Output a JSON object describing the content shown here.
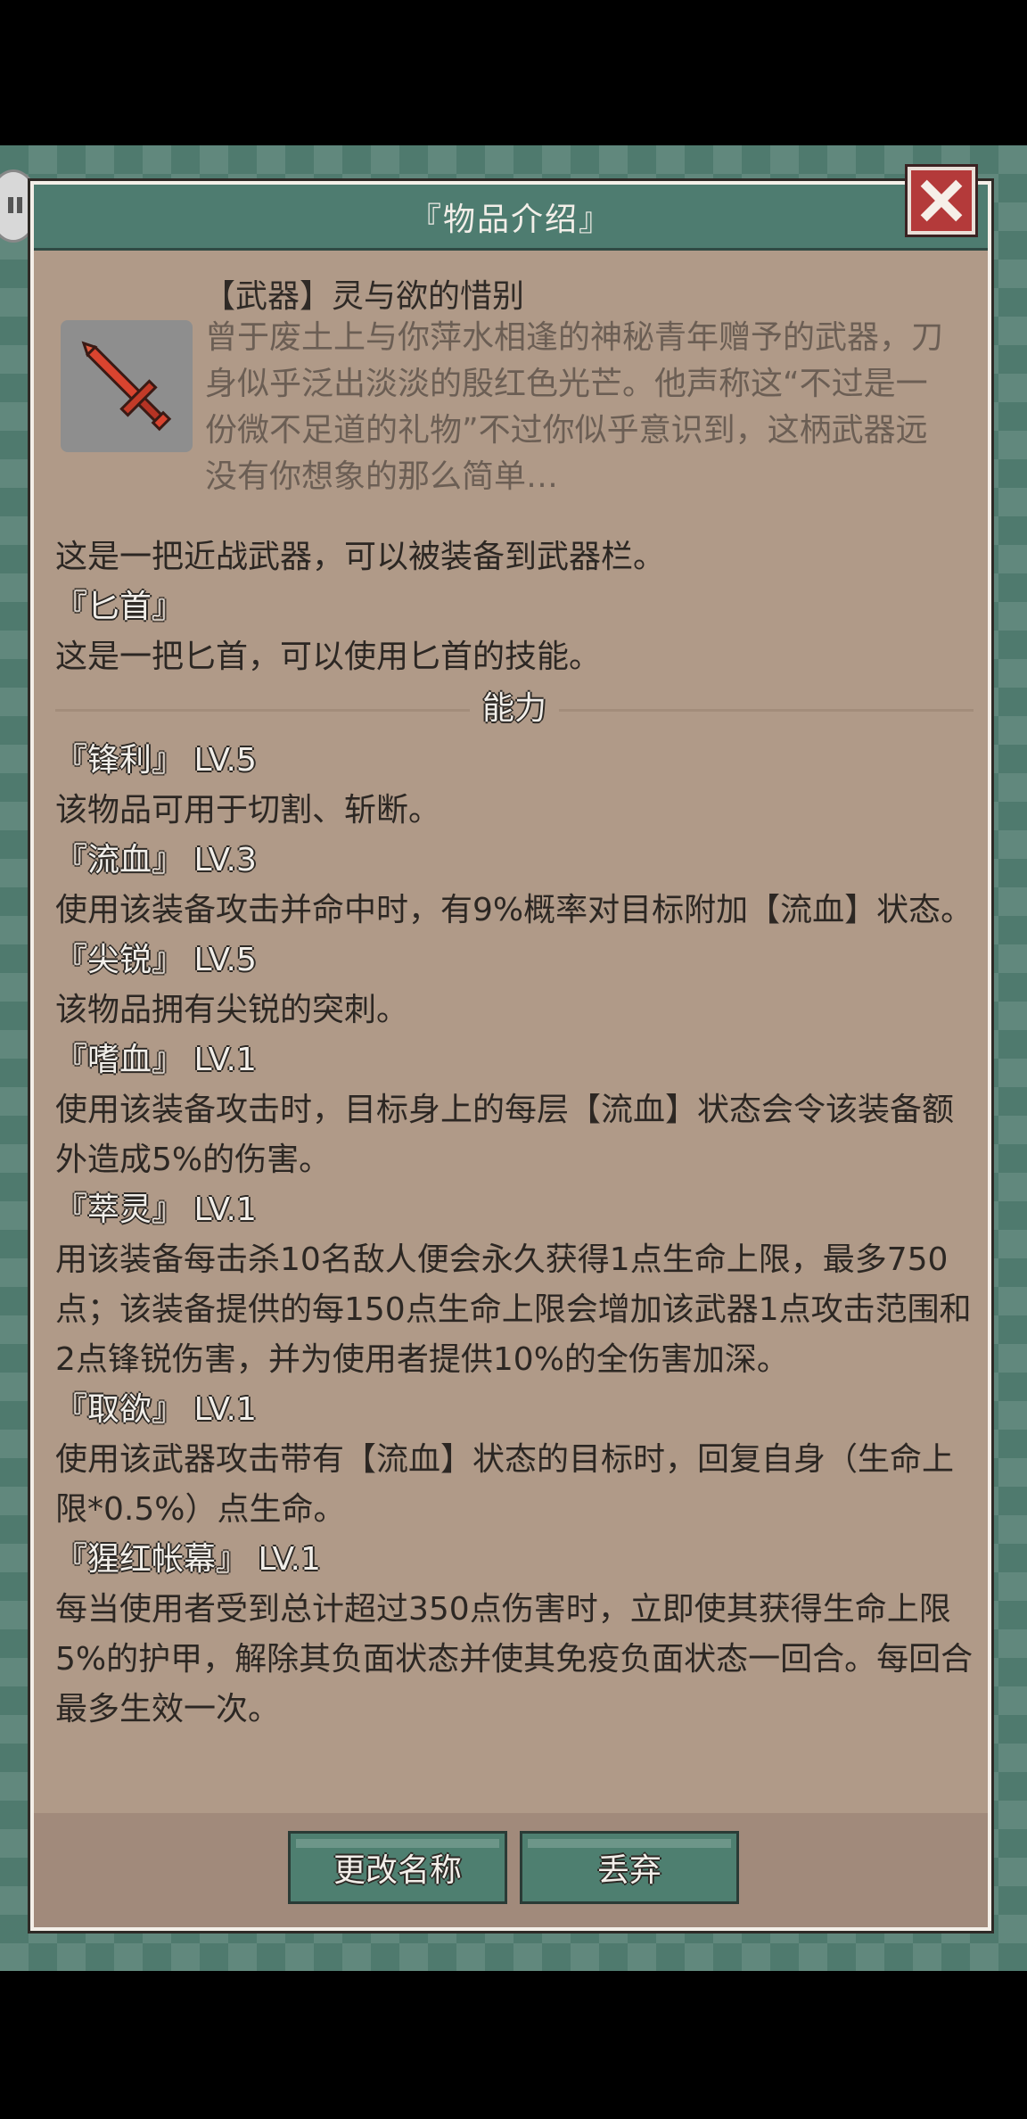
{
  "dialog": {
    "title": "『物品介绍』",
    "item_name": "【武器】灵与欲的惜别",
    "item_desc": "曾于废土上与你萍水相逢的神秘青年赠予的武器，刀身似乎泛出淡淡的殷红色光芒。他声称这“不过是一份微不足道的礼物”不过你似乎意识到，这柄武器远没有你想象的那么简单…",
    "type_line": "这是一把近战武器，可以被装备到武器栏。",
    "subtype_tag": "『匕首』",
    "subtype_desc": "这是一把匕首，可以使用匕首的技能。",
    "section_title": "能力",
    "abilities": [
      {
        "name": "『锋利』 LV.5",
        "desc": "该物品可用于切割、斩断。"
      },
      {
        "name": "『流血』 LV.3",
        "desc": "使用该装备攻击并命中时，有9%概率对目标附加【流血】状态。"
      },
      {
        "name": "『尖锐』 LV.5",
        "desc": "该物品拥有尖锐的突刺。"
      },
      {
        "name": "『嗜血』 LV.1",
        "desc": "使用该装备攻击时，目标身上的每层【流血】状态会令该装备额外造成5%的伤害。"
      },
      {
        "name": "『萃灵』 LV.1",
        "desc": "用该装备每击杀10名敌人便会永久获得1点生命上限，最多750点；该装备提供的每150点生命上限会增加该武器1点攻击范围和2点锋锐伤害，并为使用者提供10%的全伤害加深。"
      },
      {
        "name": "『取欲』 LV.1",
        "desc": "使用该武器攻击带有【流血】状态的目标时，回复自身（生命上限*0.5%）点生命。"
      },
      {
        "name": "『猩红帐幕』 LV.1",
        "desc": "每当使用者受到总计超过350点伤害时，立即使其获得生命上限5%的护甲，解除其负面状态并使其免疫负面状态一回合。每回合最多生效一次。"
      }
    ],
    "buttons": {
      "rename": "更改名称",
      "discard": "丢弃"
    }
  },
  "colors": {
    "panel": "#b09a88",
    "title_bar": "#4e7c70",
    "close": "#b43a3a",
    "button": "#4e7f70"
  }
}
